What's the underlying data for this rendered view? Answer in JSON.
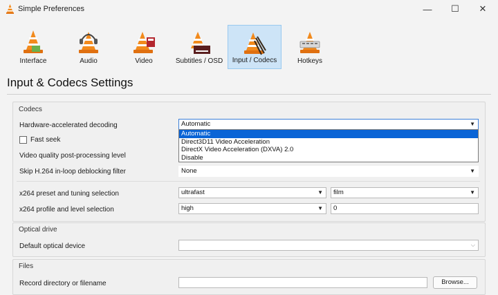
{
  "window": {
    "title": "Simple Preferences",
    "minimize_glyph": "—",
    "maximize_glyph": "☐",
    "close_glyph": "✕"
  },
  "toolbar": {
    "tabs": [
      {
        "label": "Interface",
        "icon": "cone-interface-icon"
      },
      {
        "label": "Audio",
        "icon": "cone-headphones-icon"
      },
      {
        "label": "Video",
        "icon": "cone-video-icon"
      },
      {
        "label": "Subtitles / OSD",
        "icon": "cone-subtitles-icon"
      },
      {
        "label": "Input / Codecs",
        "icon": "cone-codecs-icon"
      },
      {
        "label": "Hotkeys",
        "icon": "cone-hotkeys-icon"
      }
    ],
    "active_tab": "Input / Codecs"
  },
  "heading": "Input & Codecs Settings",
  "codecs": {
    "group_label": "Codecs",
    "hw_decoding_label": "Hardware-accelerated decoding",
    "hw_decoding_value": "Automatic",
    "hw_decoding_options": [
      "Automatic",
      "Direct3D11 Video Acceleration",
      "DirectX Video Acceleration (DXVA) 2.0",
      "Disable"
    ],
    "fast_seek_label": "Fast seek",
    "video_quality_label": "Video quality post-processing level",
    "skip_h264_label": "Skip H.264 in-loop deblocking filter",
    "skip_h264_value": "None",
    "x264_preset_label": "x264 preset and tuning selection",
    "x264_preset_value": "ultrafast",
    "x264_tune_value": "film",
    "x264_profile_label": "x264 profile and level selection",
    "x264_profile_value": "high",
    "x264_level_value": "0"
  },
  "optical": {
    "group_label": "Optical drive",
    "device_label": "Default optical device",
    "device_value": ""
  },
  "files": {
    "group_label": "Files",
    "record_label": "Record directory or filename",
    "record_value": "",
    "browse_label": "Browse..."
  },
  "colors": {
    "cone_orange": "#f28a1c",
    "selection_blue": "#0a64d6",
    "active_tab_bg": "#cde4f7"
  }
}
